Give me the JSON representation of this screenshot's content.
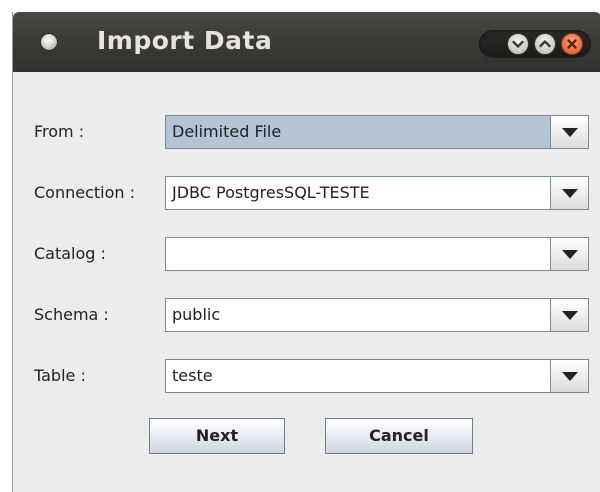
{
  "window": {
    "title": "Import Data"
  },
  "form": {
    "fields": [
      {
        "label": "From :",
        "value": "Delimited File",
        "selected": true
      },
      {
        "label": "Connection :",
        "value": "JDBC PostgresSQL-TESTE",
        "selected": false
      },
      {
        "label": "Catalog :",
        "value": "",
        "selected": false
      },
      {
        "label": "Schema :",
        "value": "public",
        "selected": false
      },
      {
        "label": "Table :",
        "value": "teste",
        "selected": false
      }
    ]
  },
  "buttons": {
    "next_label": "Next",
    "cancel_label": "Cancel"
  },
  "icons": {
    "window_menu": "window-menu-icon",
    "minimize": "minimize-icon",
    "maximize": "maximize-icon",
    "close": "close-icon",
    "dropdown": "chevron-down-icon"
  },
  "colors": {
    "titlebar": "#3c3b37",
    "title_text": "#e6e4dc",
    "close_button": "#e0541e",
    "selected_field": "#b4c4d6",
    "dialog_background": "#ececea"
  }
}
